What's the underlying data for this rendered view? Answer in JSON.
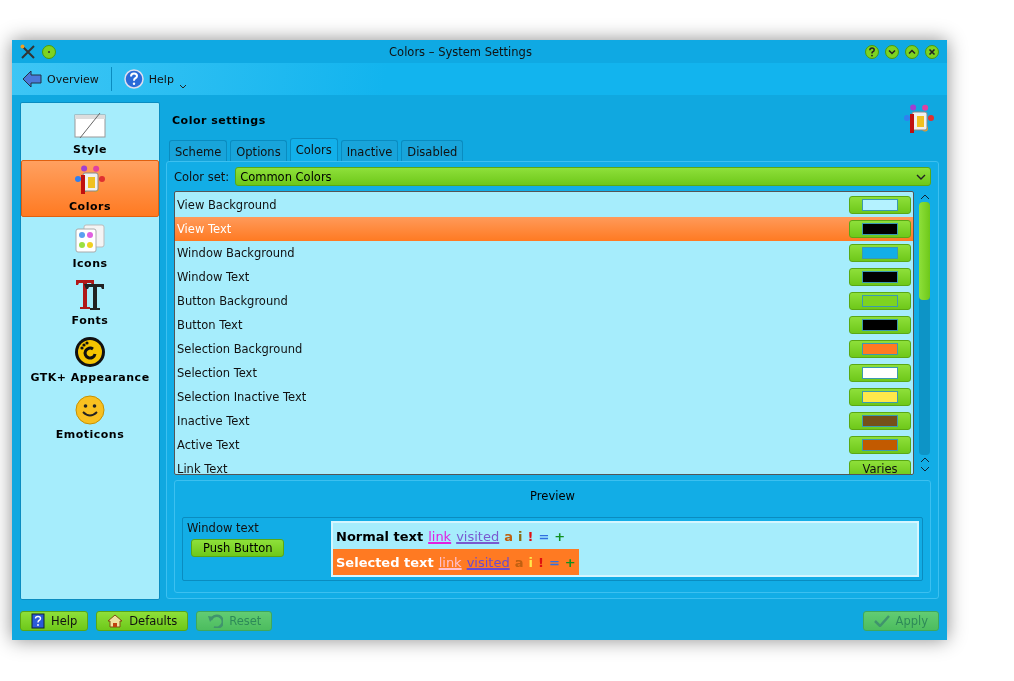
{
  "window": {
    "title": "Colors – System Settings"
  },
  "toolbar": {
    "overview": "Overview",
    "help": "Help"
  },
  "sidebar": {
    "items": [
      {
        "label": "Style",
        "selected": false,
        "kind": "style"
      },
      {
        "label": "Colors",
        "selected": true,
        "kind": "colors"
      },
      {
        "label": "Icons",
        "selected": false,
        "kind": "icons"
      },
      {
        "label": "Fonts",
        "selected": false,
        "kind": "fonts"
      },
      {
        "label": "GTK+ Appearance",
        "selected": false,
        "kind": "gtk"
      },
      {
        "label": "Emoticons",
        "selected": false,
        "kind": "emoticons"
      }
    ]
  },
  "heading": "Color settings",
  "tabs": [
    {
      "label": "Scheme",
      "selected": false
    },
    {
      "label": "Options",
      "selected": false
    },
    {
      "label": "Colors",
      "selected": true
    },
    {
      "label": "Inactive",
      "selected": false
    },
    {
      "label": "Disabled",
      "selected": false
    }
  ],
  "color_set": {
    "label": "Color set:",
    "value": "Common Colors"
  },
  "color_rows": [
    {
      "name": "View Background",
      "selected": false,
      "kind": "swatch",
      "color": "#b4f2ff"
    },
    {
      "name": "View Text",
      "selected": true,
      "kind": "swatch",
      "color": "#000000"
    },
    {
      "name": "Window Background",
      "selected": false,
      "kind": "swatch",
      "color": "#12aee8"
    },
    {
      "name": "Window Text",
      "selected": false,
      "kind": "swatch",
      "color": "#000000"
    },
    {
      "name": "Button Background",
      "selected": false,
      "kind": "swatch",
      "color": "#7ed321"
    },
    {
      "name": "Button Text",
      "selected": false,
      "kind": "swatch",
      "color": "#000000"
    },
    {
      "name": "Selection Background",
      "selected": false,
      "kind": "swatch",
      "color": "#ff7a22"
    },
    {
      "name": "Selection Text",
      "selected": false,
      "kind": "swatch",
      "color": "#ffffff"
    },
    {
      "name": "Selection Inactive Text",
      "selected": false,
      "kind": "swatch",
      "color": "#ffe84a"
    },
    {
      "name": "Inactive Text",
      "selected": false,
      "kind": "swatch",
      "color": "#75501a"
    },
    {
      "name": "Active Text",
      "selected": false,
      "kind": "swatch",
      "color": "#c25a00"
    },
    {
      "name": "Link Text",
      "selected": false,
      "kind": "text",
      "value": "Varies"
    }
  ],
  "preview": {
    "title": "Preview",
    "window_text": "Window text",
    "push_button": "Push Button",
    "normal": [
      {
        "text": "Normal text",
        "kind": "plain",
        "color": "#000000"
      },
      {
        "text": "link",
        "kind": "link",
        "color": "#e020e0"
      },
      {
        "text": "visited",
        "kind": "link",
        "color": "#7a5ad0"
      },
      {
        "text": "a",
        "kind": "plain",
        "color": "#c06010"
      },
      {
        "text": "i",
        "kind": "plain",
        "color": "#8a6a10"
      },
      {
        "text": "!",
        "kind": "plain",
        "color": "#e01010"
      },
      {
        "text": "=",
        "kind": "plain",
        "color": "#3070e0"
      },
      {
        "text": "+",
        "kind": "plain",
        "color": "#109020"
      }
    ],
    "selected": [
      {
        "text": "Selected text",
        "kind": "plain",
        "color": "#ffffff"
      },
      {
        "text": "link",
        "kind": "link",
        "color": "#ffc0d0"
      },
      {
        "text": "visited",
        "kind": "link",
        "color": "#6a4ad0"
      },
      {
        "text": "a",
        "kind": "plain",
        "color": "#c06010"
      },
      {
        "text": "i",
        "kind": "plain",
        "color": "#ffe84a"
      },
      {
        "text": "!",
        "kind": "plain",
        "color": "#e01010"
      },
      {
        "text": "=",
        "kind": "plain",
        "color": "#3070e0"
      },
      {
        "text": "+",
        "kind": "plain",
        "color": "#109020"
      }
    ]
  },
  "buttons": [
    {
      "label": "Help",
      "kind": "help",
      "disabled": false
    },
    {
      "label": "Defaults",
      "kind": "defaults",
      "disabled": false
    },
    {
      "label": "Reset",
      "kind": "reset",
      "disabled": true
    },
    {
      "label": "Apply",
      "kind": "apply",
      "disabled": true
    }
  ]
}
